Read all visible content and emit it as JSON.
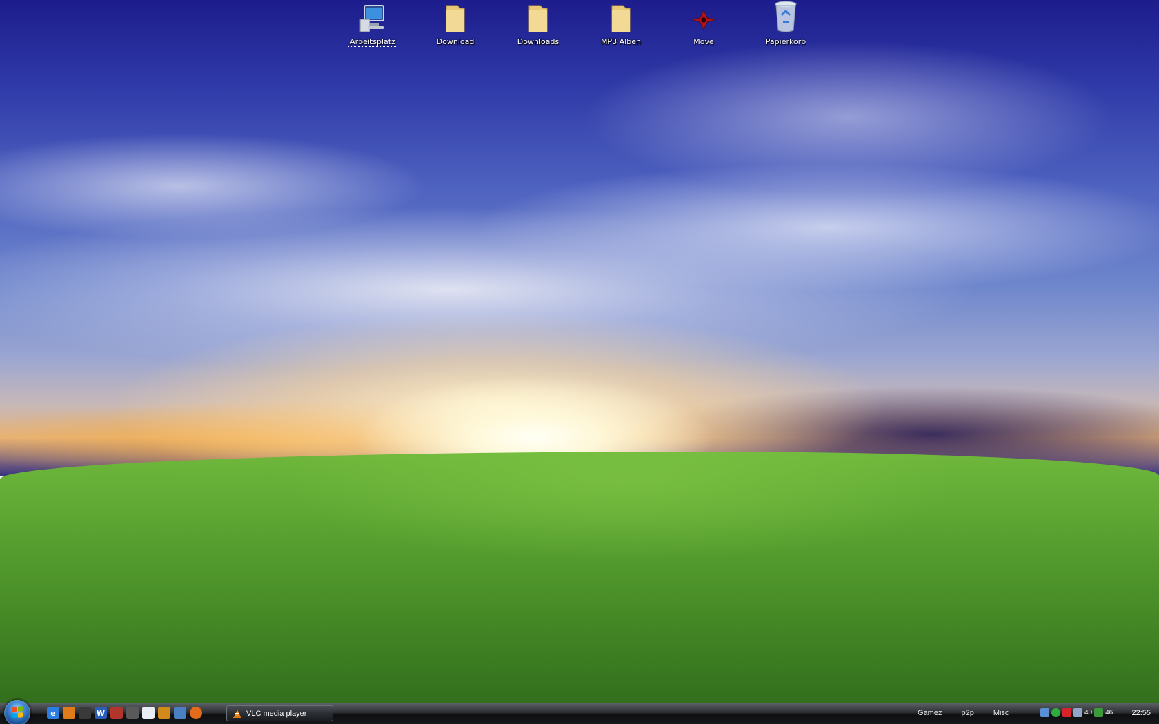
{
  "desktop": {
    "icons": [
      {
        "label": "Arbeitsplatz",
        "icon": "computer-icon",
        "selected": true
      },
      {
        "label": "Download",
        "icon": "folder-icon"
      },
      {
        "label": "Downloads",
        "icon": "folder-icon"
      },
      {
        "label": "MP3 Alben",
        "icon": "folder-icon"
      },
      {
        "label": "Move",
        "icon": "hitman-logo-icon"
      },
      {
        "label": "Papierkorb",
        "icon": "recycle-bin-icon"
      }
    ]
  },
  "taskbar": {
    "quick_launch": [
      {
        "icon": "internet-explorer-icon",
        "glyph": "e",
        "color": "#2a7de1"
      },
      {
        "icon": "network-icon",
        "glyph": "",
        "color": "#e07b1a"
      },
      {
        "icon": "steam-icon",
        "glyph": "",
        "color": "#3a3a3a"
      },
      {
        "icon": "word-icon",
        "glyph": "W",
        "color": "#2b5eb8"
      },
      {
        "icon": "game-icon",
        "glyph": "",
        "color": "#b2352b"
      },
      {
        "icon": "counter-strike-icon",
        "glyph": "",
        "color": "#5a5a5a"
      },
      {
        "icon": "document-icon",
        "glyph": "",
        "color": "#e9eef6"
      },
      {
        "icon": "messenger-icon",
        "glyph": "",
        "color": "#d28a1c"
      },
      {
        "icon": "thunderbird-icon",
        "glyph": "",
        "color": "#4a7fc1"
      },
      {
        "icon": "firefox-icon",
        "glyph": "",
        "color": "#e46b1b"
      }
    ],
    "task": {
      "label": "VLC media player",
      "icon": "vlc-cone-icon"
    },
    "toolbars": [
      "Gamez",
      "p2p",
      "Misc"
    ],
    "tray": {
      "icons": [
        "network-tray-icon",
        "antivirus-tray-icon",
        "avira-tray-icon",
        "monitor-tray-icon"
      ],
      "volume_text": "40",
      "connection_text": "46"
    },
    "clock": "22:55"
  }
}
